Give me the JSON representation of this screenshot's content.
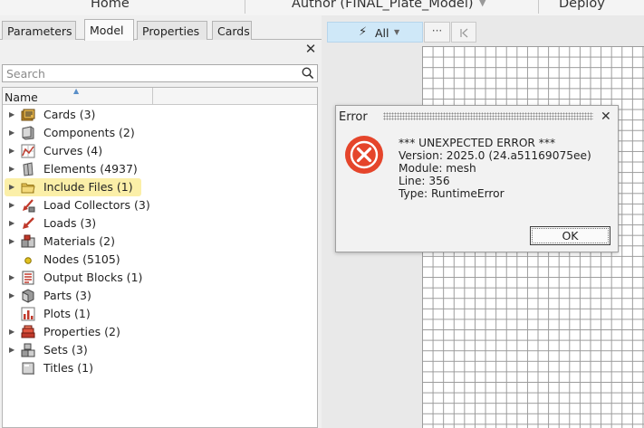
{
  "ribbon": {
    "home": "Home",
    "author": "Author (FINAL_Plate_Model)",
    "deploy": "Deploy"
  },
  "left_panel": {
    "tabs": [
      {
        "label": "Parameters",
        "active": false
      },
      {
        "label": "Model",
        "active": true
      },
      {
        "label": "Properties",
        "active": false
      },
      {
        "label": "Cards",
        "active": false
      }
    ],
    "search": {
      "placeholder": "Search",
      "value": ""
    },
    "tree": {
      "column_header": "Name",
      "items": [
        {
          "label": "Cards  (3)",
          "icon": "cards-icon",
          "expandable": true
        },
        {
          "label": "Components  (2)",
          "icon": "components-icon",
          "expandable": true
        },
        {
          "label": "Curves  (4)",
          "icon": "curves-icon",
          "expandable": true
        },
        {
          "label": "Elements  (4937)",
          "icon": "elements-icon",
          "expandable": true
        },
        {
          "label": "Include Files  (1)",
          "icon": "folder-icon",
          "expandable": true,
          "highlighted": true
        },
        {
          "label": "Load Collectors  (3)",
          "icon": "load-collectors-icon",
          "expandable": true
        },
        {
          "label": "Loads  (3)",
          "icon": "loads-icon",
          "expandable": true
        },
        {
          "label": "Materials  (2)",
          "icon": "materials-icon",
          "expandable": true
        },
        {
          "label": "Nodes  (5105)",
          "icon": "nodes-icon",
          "expandable": false
        },
        {
          "label": "Output Blocks  (1)",
          "icon": "output-blocks-icon",
          "expandable": true
        },
        {
          "label": "Parts  (3)",
          "icon": "parts-icon",
          "expandable": true
        },
        {
          "label": "Plots  (1)",
          "icon": "plots-icon",
          "expandable": false
        },
        {
          "label": "Properties  (2)",
          "icon": "properties-icon",
          "expandable": true
        },
        {
          "label": "Sets  (3)",
          "icon": "sets-icon",
          "expandable": true
        },
        {
          "label": "Titles  (1)",
          "icon": "titles-icon",
          "expandable": false
        }
      ]
    }
  },
  "toolbar": {
    "filter_label": "All",
    "more_label": "···"
  },
  "dialog": {
    "title": "Error",
    "lines": [
      "*** UNEXPECTED ERROR ***",
      "Version: 2025.0 (24.a51169075ee)",
      "Module: mesh",
      "Line: 356",
      "Type: RuntimeError"
    ],
    "ok_label": "OK"
  },
  "colors": {
    "highlight": "#fbefa8",
    "error_icon": "#e5452b",
    "filter_button": "#cfe8f8"
  }
}
